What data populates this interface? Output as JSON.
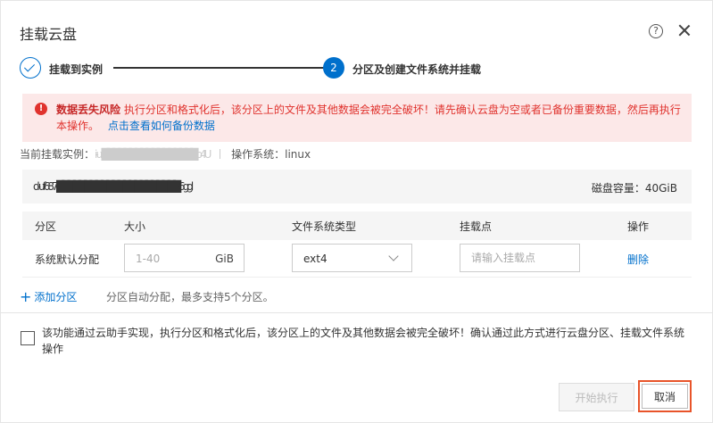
{
  "dialog": {
    "title": "挂载云盘",
    "help_icon": "question-circle-icon",
    "close_icon": "close-icon"
  },
  "steps": [
    {
      "label": "挂载到实例",
      "state": "done"
    },
    {
      "number": "2",
      "label": "分区及创建文件系统并挂载",
      "state": "active"
    }
  ],
  "alert": {
    "icon": "exclamation-circle-icon",
    "title": "数据丢失风险",
    "text": "执行分区和格式化后，该分区上的文件及其他数据会被完全破坏！请先确认云盘为空或者已备份重要数据，然后再执行本操作。",
    "link": "点击查看如何备份数据",
    "color": "#e0332e"
  },
  "instance": {
    "label": "当前挂载实例：",
    "id": "i-uf█████████████████b4U",
    "os_label": "操作系统：",
    "os": "linux"
  },
  "disk": {
    "id": "d-uf687i██████████████████████6ggl",
    "capacity": "磁盘容量：40GiB"
  },
  "table": {
    "headers": [
      "分区",
      "大小",
      "文件系统类型",
      "挂载点",
      "操作"
    ],
    "rows": [
      {
        "name": "系统默认分配",
        "size_placeholder": "1-40",
        "size_unit": "GiB",
        "fs_type": "ext4",
        "mount_placeholder": "请输入挂载点",
        "action": "删除"
      }
    ]
  },
  "add_partition": {
    "label": "添加分区",
    "hint": "分区自动分配，最多支持5个分区。"
  },
  "confirm": {
    "text": "该功能通过云助手实现，执行分区和格式化后，该分区上的文件及其他数据会被完全破坏！确认通过此方式进行云盘分区、挂载文件系统操作"
  },
  "footer": {
    "start_label": "开始执行",
    "cancel_label": "取消"
  },
  "colors": {
    "accent": "#0070cc",
    "danger": "#e0332e",
    "highlight_border": "#e8542a"
  }
}
